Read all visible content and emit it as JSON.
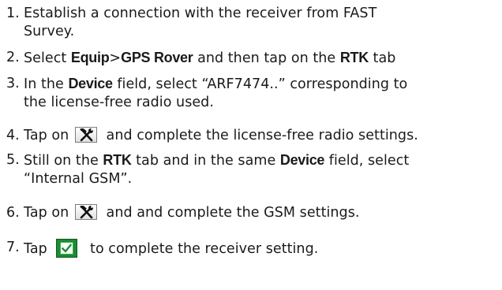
{
  "steps": [
    {
      "number": "1.",
      "line1": "Establish a connection with the receiver from FAST",
      "line2": "Survey."
    },
    {
      "number": "2.",
      "t1": "Select ",
      "b1": "Equip",
      "t2": ">",
      "b2": "GPS Rover",
      "t3": " and then tap on the ",
      "b3": "RTK",
      "t4": " tab"
    },
    {
      "number": "3.",
      "t1": "In the ",
      "b1": "Device",
      "t2": " field, select “ARF7474..” corresponding to",
      "line2": "the license-free radio used."
    },
    {
      "number": "4.",
      "t1": "Tap on",
      "t2": "and complete the license-free radio settings."
    },
    {
      "number": "5.",
      "t1": "Still on the ",
      "b1": "RTK",
      "t2": " tab and in the same ",
      "b2": "Device",
      "t3": " field, select",
      "line2": "“Internal GSM”."
    },
    {
      "number": "6.",
      "t1": "Tap on",
      "t2": "and and complete the GSM settings."
    },
    {
      "number": "7.",
      "t1": "Tap",
      "t2": "to complete the receiver setting."
    }
  ],
  "icons": {
    "settings_button": "tools-icon",
    "ok_button": "green-check-icon",
    "ok_color": "#1c8b34"
  }
}
